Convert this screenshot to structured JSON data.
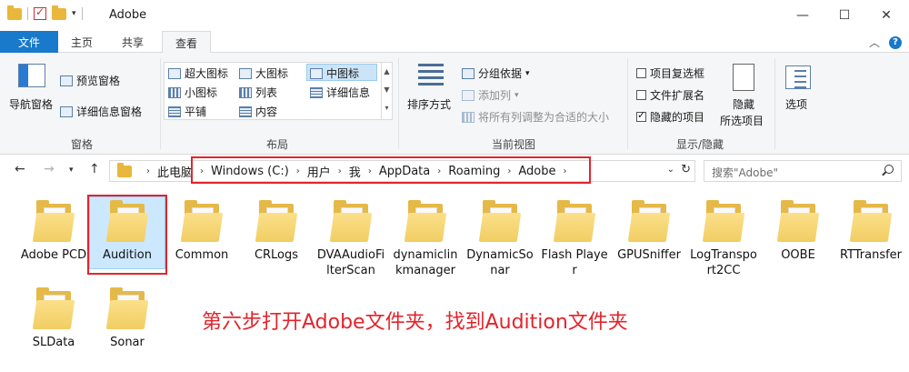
{
  "window": {
    "title": "Adobe",
    "minimize": "—",
    "maximize": "☐",
    "close": "✕"
  },
  "menu": {
    "file": "文件",
    "home": "主页",
    "share": "共享",
    "view": "查看"
  },
  "ribbon": {
    "panes": {
      "nav_pane": "导航窗格",
      "preview_pane": "预览窗格",
      "details_pane": "详细信息窗格",
      "label": "窗格"
    },
    "layout": {
      "extra_large": "超大图标",
      "large": "大图标",
      "medium": "中图标",
      "small": "小图标",
      "list": "列表",
      "details": "详细信息",
      "tiles": "平铺",
      "content": "内容",
      "label": "布局"
    },
    "current_view": {
      "sort": "排序方式",
      "group_by": "分组依据",
      "add_column": "添加列",
      "fit_columns": "将所有列调整为合适的大小",
      "label": "当前视图"
    },
    "show_hide": {
      "item_checkboxes": "项目复选框",
      "file_extensions": "文件扩展名",
      "hidden_items": "隐藏的项目",
      "hide_selected_1": "隐藏",
      "hide_selected_2": "所选项目",
      "label": "显示/隐藏",
      "item_checkboxes_checked": false,
      "file_extensions_checked": false,
      "hidden_items_checked": true
    },
    "options": "选项"
  },
  "address": {
    "crumbs": [
      "此电脑",
      "Windows (C:)",
      "用户",
      "我",
      "AppData",
      "Roaming",
      "Adobe"
    ],
    "search_placeholder": "搜索\"Adobe\""
  },
  "folders": [
    {
      "name": "Adobe PCD"
    },
    {
      "name": "Audition",
      "selected": true
    },
    {
      "name": "Common"
    },
    {
      "name": "CRLogs"
    },
    {
      "name": "DVAAudioFilterScan"
    },
    {
      "name": "dynamiclinkmanager"
    },
    {
      "name": "DynamicSonar"
    },
    {
      "name": "Flash Player"
    },
    {
      "name": "GPUSniffer"
    },
    {
      "name": "LogTransport2CC"
    },
    {
      "name": "OOBE"
    },
    {
      "name": "RTTransfer"
    },
    {
      "name": "SLData"
    },
    {
      "name": "Sonar"
    }
  ],
  "annotation": "第六步打开Adobe文件夹，找到Audition文件夹",
  "colors": {
    "accent": "#1979ca",
    "highlight_red": "#e3242b",
    "selection": "#cce8ff"
  }
}
